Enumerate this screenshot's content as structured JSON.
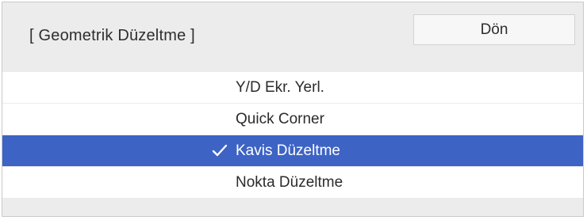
{
  "dialog": {
    "title": "[ Geometrik Düzeltme ]",
    "back_label": "Dön"
  },
  "menu": {
    "items": [
      {
        "label": "Y/D Ekr. Yerl.",
        "selected": false
      },
      {
        "label": "Quick Corner",
        "selected": false
      },
      {
        "label": "Kavis Düzeltme",
        "selected": true
      },
      {
        "label": "Nokta Düzeltme",
        "selected": false
      }
    ]
  },
  "colors": {
    "selection": "#3d63c4",
    "panel_background": "#ececec",
    "item_background": "#ffffff"
  },
  "icons": {
    "selected_marker": "check-icon"
  }
}
